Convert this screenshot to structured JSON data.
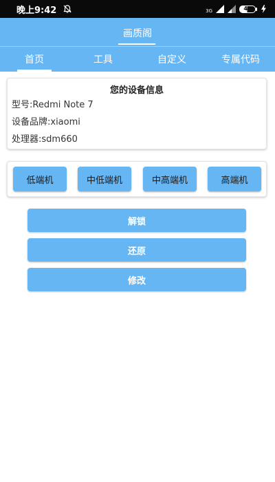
{
  "status_bar": {
    "time": "晚上9:42",
    "network": "3G",
    "battery": "47",
    "icons": [
      "alarm-off-icon",
      "signal-icon",
      "battery-icon",
      "charging-icon"
    ]
  },
  "header": {
    "title": "画质阁"
  },
  "tabs": [
    {
      "label": "首页",
      "active": true
    },
    {
      "label": "工具",
      "active": false
    },
    {
      "label": "自定义",
      "active": false
    },
    {
      "label": "专属代码",
      "active": false
    }
  ],
  "device_info": {
    "title": "您的设备信息",
    "model": "型号:Redmi Note 7",
    "brand": "设备品牌:xiaomi",
    "processor": "处理器:sdm660"
  },
  "tiers": {
    "low": "低端机",
    "mid_low": "中低端机",
    "mid_high": "中高端机",
    "high": "高端机"
  },
  "actions": {
    "unlock": "解锁",
    "restore": "还原",
    "modify": "修改"
  },
  "colors": {
    "accent": "#67b6f4",
    "status_bar": "#0a0a0a",
    "background": "#ffffff"
  }
}
